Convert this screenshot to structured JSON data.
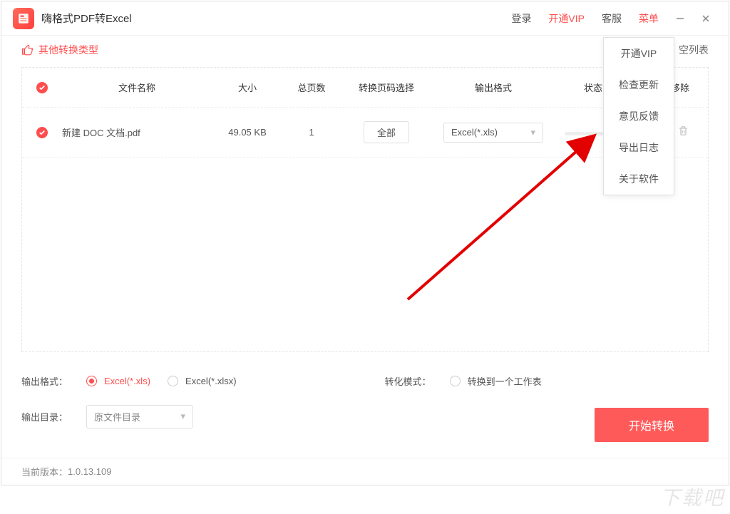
{
  "header": {
    "app_title": "嗨格式PDF转Excel",
    "nav": {
      "login": "登录",
      "vip": "开通VIP",
      "support": "客服",
      "menu": "菜单"
    }
  },
  "toolbar": {
    "other_types": "其他转换类型",
    "clear_list": "空列表"
  },
  "menu": {
    "items": [
      "开通VIP",
      "检查更新",
      "意见反馈",
      "导出日志",
      "关于软件"
    ]
  },
  "table": {
    "headers": {
      "filename": "文件名称",
      "size": "大小",
      "pages": "总页数",
      "page_select": "转换页码选择",
      "output_format": "输出格式",
      "status": "状态",
      "remove": "移除"
    },
    "rows": [
      {
        "filename": "新建 DOC 文档.pdf",
        "size": "49.05 KB",
        "pages": "1",
        "page_select_btn": "全部",
        "format_selected": "Excel(*.xls)"
      }
    ]
  },
  "options": {
    "out_format_label": "输出格式：",
    "fmt_xls": "Excel(*.xls)",
    "fmt_xlsx": "Excel(*.xlsx)",
    "convert_mode_label": "转化模式：",
    "mode_single_sheet": "转换到一个工作表",
    "out_dir_label": "输出目录：",
    "out_dir_value": "原文件目录"
  },
  "actions": {
    "start_convert": "开始转换"
  },
  "footer": {
    "version_label": "当前版本：",
    "version_value": "1.0.13.109"
  },
  "watermark": "下载吧"
}
